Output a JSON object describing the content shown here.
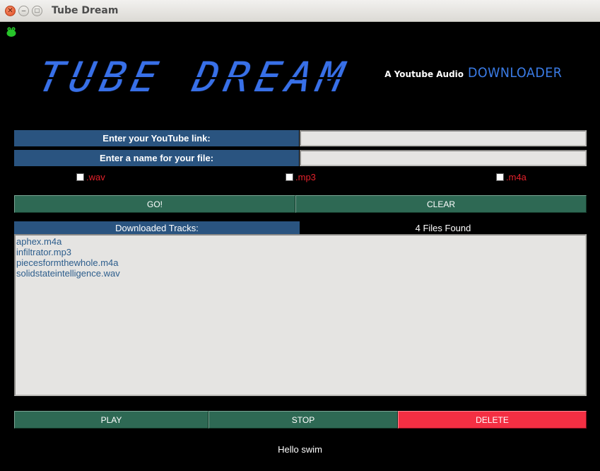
{
  "window": {
    "title": "Tube Dream"
  },
  "logo": {
    "text": "TUBE DREAM"
  },
  "tagline": {
    "small": "A Youtube Audio",
    "big": "DOWNLOADER"
  },
  "form": {
    "link_label": "Enter your YouTube link:",
    "link_value": "",
    "name_label": "Enter a name for your file:",
    "name_value": ""
  },
  "formats": [
    {
      "label": ".wav",
      "checked": false
    },
    {
      "label": ".mp3",
      "checked": false
    },
    {
      "label": ".m4a",
      "checked": false
    }
  ],
  "buttons": {
    "go": "GO!",
    "clear": "CLEAR",
    "play": "PLAY",
    "stop": "STOP",
    "delete": "DELETE"
  },
  "tracks": {
    "header": "Downloaded Tracks:",
    "count": "4 Files Found",
    "items": [
      "aphex.m4a",
      "infiltrator.mp3",
      "piecesformthewhole.m4a",
      "solidstateintelligence.wav"
    ]
  },
  "status": "Hello swim",
  "colors": {
    "accent_blue": "#3870e8",
    "label_bg": "#2a5480",
    "button_green": "#2e6954",
    "delete_red": "#f42f43",
    "format_red": "#e5212b"
  }
}
